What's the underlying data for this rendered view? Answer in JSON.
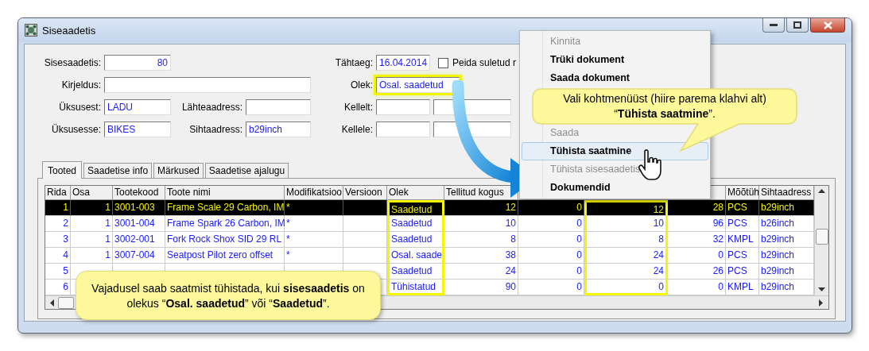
{
  "window": {
    "title": "Siseaadetis"
  },
  "form": [
    {
      "label": "Sisesaadetis:",
      "value": "80",
      "highlighted": false
    },
    {
      "label": "Kirjeldus:",
      "highlighted": false
    },
    {
      "label": "Üksusest:",
      "value": "LADU",
      "highlighted": false
    },
    {
      "label": "Üksusesse:",
      "value": "BIKES",
      "highlighted": false
    },
    {
      "label": "Lähteaadress:",
      "highlighted": false
    },
    {
      "label": "Sihtaadress:",
      "value": "b29inch",
      "highlighted": false
    },
    {
      "label": "Tähtaeg:",
      "value": "16.04.2014",
      "highlighted": false
    },
    {
      "label": "Olek:",
      "value": "Osal. saadetud",
      "highlighted": true
    },
    {
      "label": "Kellelt:",
      "highlighted": false
    },
    {
      "label": "Kellele:",
      "highlighted": false
    }
  ],
  "hide_closed": {
    "label": "Peida suletud r",
    "checked": false
  },
  "tabs": [
    {
      "label": "Tooted",
      "selected": true
    },
    {
      "label": "Saadetise info",
      "selected": false
    },
    {
      "label": "Märkused",
      "selected": false
    },
    {
      "label": "Saadetise ajalugu",
      "selected": false
    }
  ],
  "table": {
    "columns": [
      {
        "label": "Rida",
        "kind": "number",
        "highlighted": false
      },
      {
        "label": "Osa",
        "kind": "number",
        "highlighted": false
      },
      {
        "label": "Tootekood",
        "kind": "text",
        "highlighted": false
      },
      {
        "label": "Toote nimi",
        "kind": "text",
        "highlighted": false
      },
      {
        "label": "Modifikatsioo",
        "kind": "text",
        "highlighted": false
      },
      {
        "label": "Versioon",
        "kind": "text",
        "highlighted": false
      },
      {
        "label": "Olek",
        "kind": "text",
        "highlighted": true
      },
      {
        "label": "Tellitud kogus",
        "kind": "number",
        "highlighted": false
      },
      {
        "kind": "number",
        "highlighted": false
      },
      {
        "kind": "number",
        "highlighted": true
      },
      {
        "kind": "number",
        "highlighted": false
      },
      {
        "label": "Mõõtüh",
        "kind": "text",
        "highlighted": false
      },
      {
        "label": "Sihtaadress",
        "kind": "text",
        "highlighted": false
      }
    ],
    "rows": [
      {
        "selected": true,
        "cells": [
          "1",
          "1",
          "3001-003",
          "Frame Scale 29 Carbon, IM",
          "*",
          null,
          "Saadetud",
          "12",
          "0",
          "12",
          "28",
          "PCS",
          "b29inch"
        ]
      },
      {
        "selected": false,
        "cells": [
          "2",
          "1",
          "3001-004",
          "Frame Spark 26 Carbon, IM",
          "*",
          null,
          "Saadetud",
          "10",
          "0",
          "10",
          "96",
          "PCS",
          "b26inch"
        ]
      },
      {
        "selected": false,
        "cells": [
          "3",
          "1",
          "3002-001",
          "Fork Rock Shox SID 29 RL",
          "*",
          null,
          "Saadetud",
          "8",
          "0",
          "8",
          "32",
          "KMPL",
          "b29inch"
        ]
      },
      {
        "selected": false,
        "cells": [
          "4",
          "1",
          "3007-004",
          "Seatpost Pilot zero offset",
          "*",
          null,
          "Osal. saade",
          "38",
          "0",
          "24",
          "0",
          "PCS",
          "b29inch"
        ]
      },
      {
        "selected": false,
        "cells": [
          "5",
          null,
          null,
          null,
          null,
          null,
          "Saadetud",
          "24",
          "0",
          "24",
          "26",
          "PCS",
          "b29inch"
        ]
      },
      {
        "selected": false,
        "cells": [
          "6",
          null,
          null,
          null,
          null,
          null,
          "Tühistatud",
          "90",
          "0",
          "0",
          "0",
          "KMPL",
          "b29inch"
        ]
      }
    ]
  },
  "context_menu": {
    "items": [
      {
        "label": "Kinnita",
        "disabled": true,
        "selected": false
      },
      {
        "label": "Trüki dokument",
        "disabled": false,
        "selected": false
      },
      {
        "label": "Saada dokument",
        "disabled": false,
        "selected": false
      },
      {
        "label": "Saada",
        "disabled": true,
        "selected": false
      },
      {
        "label": "Tühista saatmine",
        "disabled": false,
        "selected": true
      },
      {
        "label": "Tühista sisesaadetis",
        "disabled": true,
        "selected": false
      },
      {
        "label": "Dokumendid",
        "disabled": false,
        "selected": false
      }
    ]
  },
  "callouts": [
    {
      "text": "Vali kohtmenüüst (hiire parema klahvi alt) “**Tühista saatmine**”."
    },
    {
      "text": "Vajadusel saab saatmist tühistada, kui **sisesaadetis** on olekus “**Osal. saadetud**” või “**Saadetud**”."
    }
  ]
}
